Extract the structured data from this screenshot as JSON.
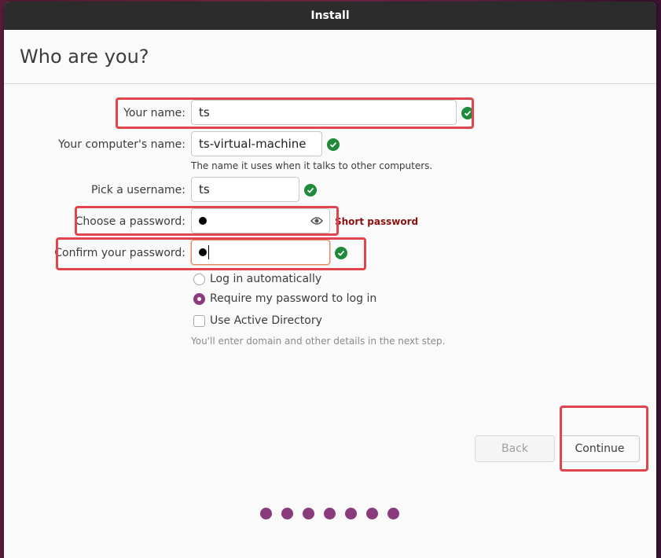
{
  "window": {
    "title": "Install"
  },
  "page": {
    "title": "Who are you?"
  },
  "form": {
    "name": {
      "label": "Your name:",
      "value": "ts"
    },
    "computer": {
      "label": "Your computer's name:",
      "value": "ts-virtual-machine",
      "hint": "The name it uses when it talks to other computers."
    },
    "username": {
      "label": "Pick a username:",
      "value": "ts"
    },
    "password": {
      "label": "Choose a password:",
      "warning": "Short password"
    },
    "confirm": {
      "label": "Confirm your password:"
    }
  },
  "login_options": {
    "auto": "Log in automatically",
    "require": "Require my password to log in",
    "active_directory": "Use Active Directory",
    "ad_hint": "You'll enter domain and other details in the next step."
  },
  "buttons": {
    "back": "Back",
    "continue": "Continue"
  },
  "progress": {
    "total_steps": 7
  },
  "colors": {
    "accent": "#8a3b7d",
    "valid": "#1e8a3a",
    "highlight": "#e0454e",
    "warning": "#8a1010"
  }
}
